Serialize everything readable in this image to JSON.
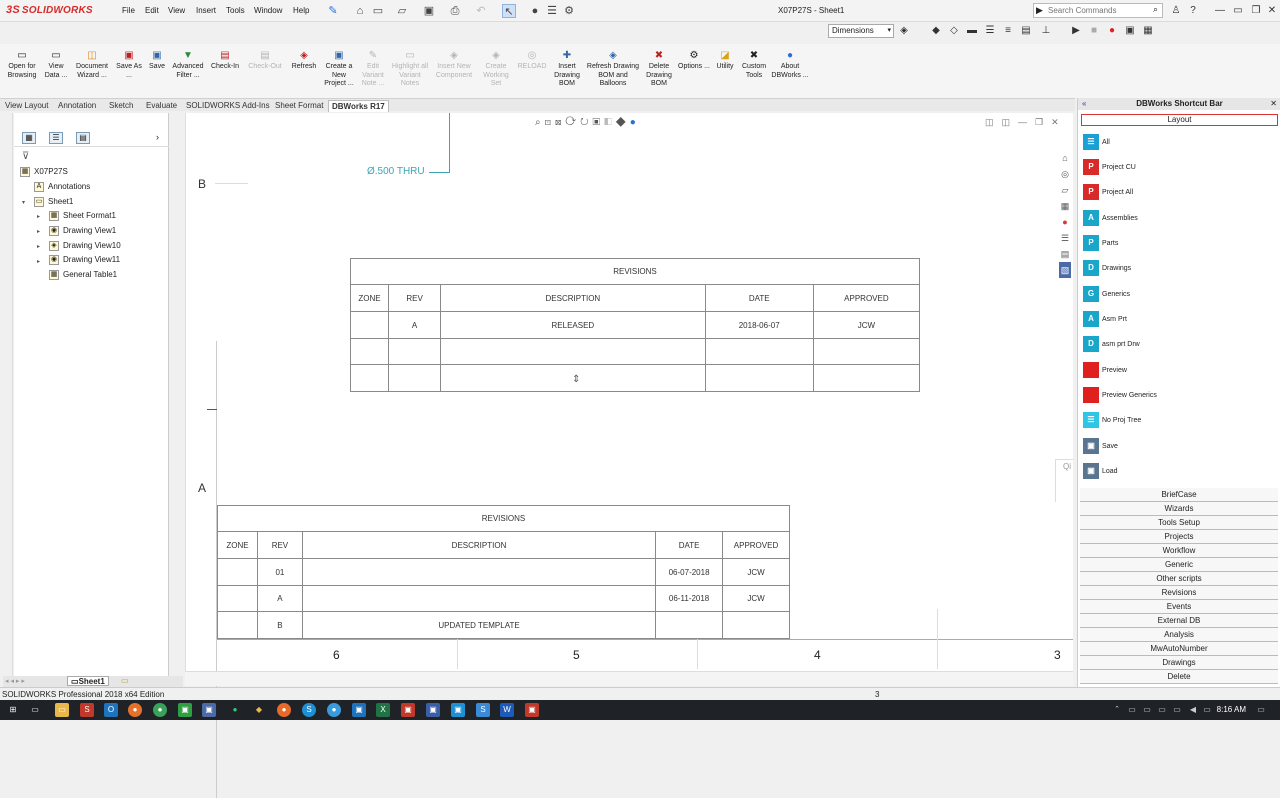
{
  "app": {
    "logo": "SOLIDWORKS",
    "title": "X07P27S - Sheet1",
    "menu": [
      "File",
      "Edit",
      "View",
      "Insert",
      "Tools",
      "Window",
      "Help"
    ],
    "search_placeholder": "Search Commands",
    "dimensions_select": "Dimensions"
  },
  "ribbon": [
    {
      "label": "Open for Browsing",
      "icon": "open-folder-icon",
      "disabled": false
    },
    {
      "label": "View Data ...",
      "icon": "view-data-icon",
      "disabled": false
    },
    {
      "label": "Document Wizard ...",
      "icon": "document-wizard-icon",
      "disabled": false
    },
    {
      "label": "Save As ...",
      "icon": "save-as-icon",
      "disabled": false
    },
    {
      "label": "Save",
      "icon": "save-icon",
      "disabled": false
    },
    {
      "label": "Advanced Filter ...",
      "icon": "filter-icon",
      "disabled": false
    },
    {
      "label": "Check-In",
      "icon": "check-in-icon",
      "disabled": false
    },
    {
      "label": "Check-Out",
      "icon": "check-out-icon",
      "disabled": true
    },
    {
      "label": "Refresh",
      "icon": "refresh-icon",
      "disabled": false
    },
    {
      "label": "Create a New Project ...",
      "icon": "new-project-icon",
      "disabled": false
    },
    {
      "label": "Edit Variant Note ...",
      "icon": "edit-variant-icon",
      "disabled": true
    },
    {
      "label": "Highlight all Variant Notes",
      "icon": "highlight-icon",
      "disabled": true
    },
    {
      "label": "Insert New Component",
      "icon": "insert-component-icon",
      "disabled": true
    },
    {
      "label": "Create Working Set",
      "icon": "working-set-icon",
      "disabled": true
    },
    {
      "label": "RELOAD",
      "icon": "reload-icon",
      "disabled": true
    },
    {
      "label": "Insert Drawing BOM",
      "icon": "insert-bom-icon",
      "disabled": false
    },
    {
      "label": "Refresh Drawing BOM and Balloons",
      "icon": "refresh-bom-icon",
      "disabled": false
    },
    {
      "label": "Delete Drawing BOM",
      "icon": "delete-bom-icon",
      "disabled": false
    },
    {
      "label": "Options ...",
      "icon": "options-icon",
      "disabled": false
    },
    {
      "label": "Utility",
      "icon": "utility-icon",
      "disabled": false
    },
    {
      "label": "Custom Tools",
      "icon": "custom-tools-icon",
      "disabled": false
    },
    {
      "label": "About DBWorks ...",
      "icon": "info-icon",
      "disabled": false
    }
  ],
  "tabs": [
    "View Layout",
    "Annotation",
    "Sketch",
    "Evaluate",
    "SOLIDWORKS Add-Ins",
    "Sheet Format",
    "DBWorks R17"
  ],
  "active_tab": "DBWorks R17",
  "tree": {
    "root": "X07P27S",
    "items": [
      {
        "label": "Annotations",
        "level": 1
      },
      {
        "label": "Sheet1",
        "level": 1
      },
      {
        "label": "Sheet Format1",
        "level": 2
      },
      {
        "label": "Drawing View1",
        "level": 2
      },
      {
        "label": "Drawing View10",
        "level": 2
      },
      {
        "label": "Drawing View11",
        "level": 2
      },
      {
        "label": "General Table1",
        "level": 2
      }
    ],
    "sheet_tab": "Sheet1"
  },
  "drawing": {
    "thru_note": "Ø.500 THRU",
    "zone_b": "B",
    "zone_a": "A",
    "zones_bottom": [
      "6",
      "5",
      "4",
      "3"
    ],
    "table1": {
      "title": "REVISIONS",
      "headers": [
        "ZONE",
        "REV",
        "DESCRIPTION",
        "DATE",
        "APPROVED"
      ],
      "rows": [
        [
          "",
          "A",
          "RELEASED",
          "2018-06-07",
          "JCW"
        ],
        [
          "",
          "",
          "",
          "",
          ""
        ],
        [
          "",
          "",
          "",
          "",
          ""
        ]
      ]
    },
    "table2": {
      "title": "REVISIONS",
      "headers": [
        "ZONE",
        "REV",
        "DESCRIPTION",
        "DATE",
        "APPROVED"
      ],
      "rows": [
        [
          "",
          "01",
          "",
          "06-07-2018",
          "JCW"
        ],
        [
          "",
          "A",
          "",
          "06-11-2018",
          "JCW"
        ],
        [
          "",
          "B",
          "UPDATED TEMPLATE",
          "",
          ""
        ]
      ]
    }
  },
  "pane": {
    "title": "DBWorks Shortcut Bar",
    "layout": "Layout",
    "shortcuts": [
      {
        "label": "All",
        "icon_color": "#1a9fd6",
        "letter": ""
      },
      {
        "label": "Project CU",
        "icon_color": "#d92a2a",
        "letter": "P"
      },
      {
        "label": "Project All",
        "icon_color": "#d92a2a",
        "letter": "P"
      },
      {
        "label": "Assemblies",
        "icon_color": "#1aa6c8",
        "letter": "A"
      },
      {
        "label": "Parts",
        "icon_color": "#1aa6c8",
        "letter": "P"
      },
      {
        "label": "Drawings",
        "icon_color": "#1aa6c8",
        "letter": "D"
      },
      {
        "label": "Generics",
        "icon_color": "#1aa6c8",
        "letter": "G"
      },
      {
        "label": "Asm Prt",
        "icon_color": "#1aa6c8",
        "letter": "A"
      },
      {
        "label": "asm prt Drw",
        "icon_color": "#1aa6c8",
        "letter": "D"
      },
      {
        "label": "Preview",
        "icon_color": "#e01f1f",
        "letter": ""
      },
      {
        "label": "Preview Generics",
        "icon_color": "#e01f1f",
        "letter": ""
      },
      {
        "label": "No Proj Tree",
        "icon_color": "#2fc6e6",
        "letter": ""
      },
      {
        "label": "Save",
        "icon_color": "#5a7590",
        "letter": ""
      },
      {
        "label": "Load",
        "icon_color": "#5a7590",
        "letter": ""
      }
    ],
    "sections": [
      "BriefCase",
      "Wizards",
      "Tools Setup",
      "Projects",
      "Workflow",
      "Generic",
      "Other scripts",
      "Revisions",
      "Events",
      "External DB",
      "Analysis",
      "MwAutoNumber",
      "Drawings",
      "Delete"
    ]
  },
  "status": {
    "edition": "SOLIDWORKS Professional 2018 x64 Edition",
    "num": "3"
  },
  "taskbar": {
    "time": "8:16 AM"
  }
}
